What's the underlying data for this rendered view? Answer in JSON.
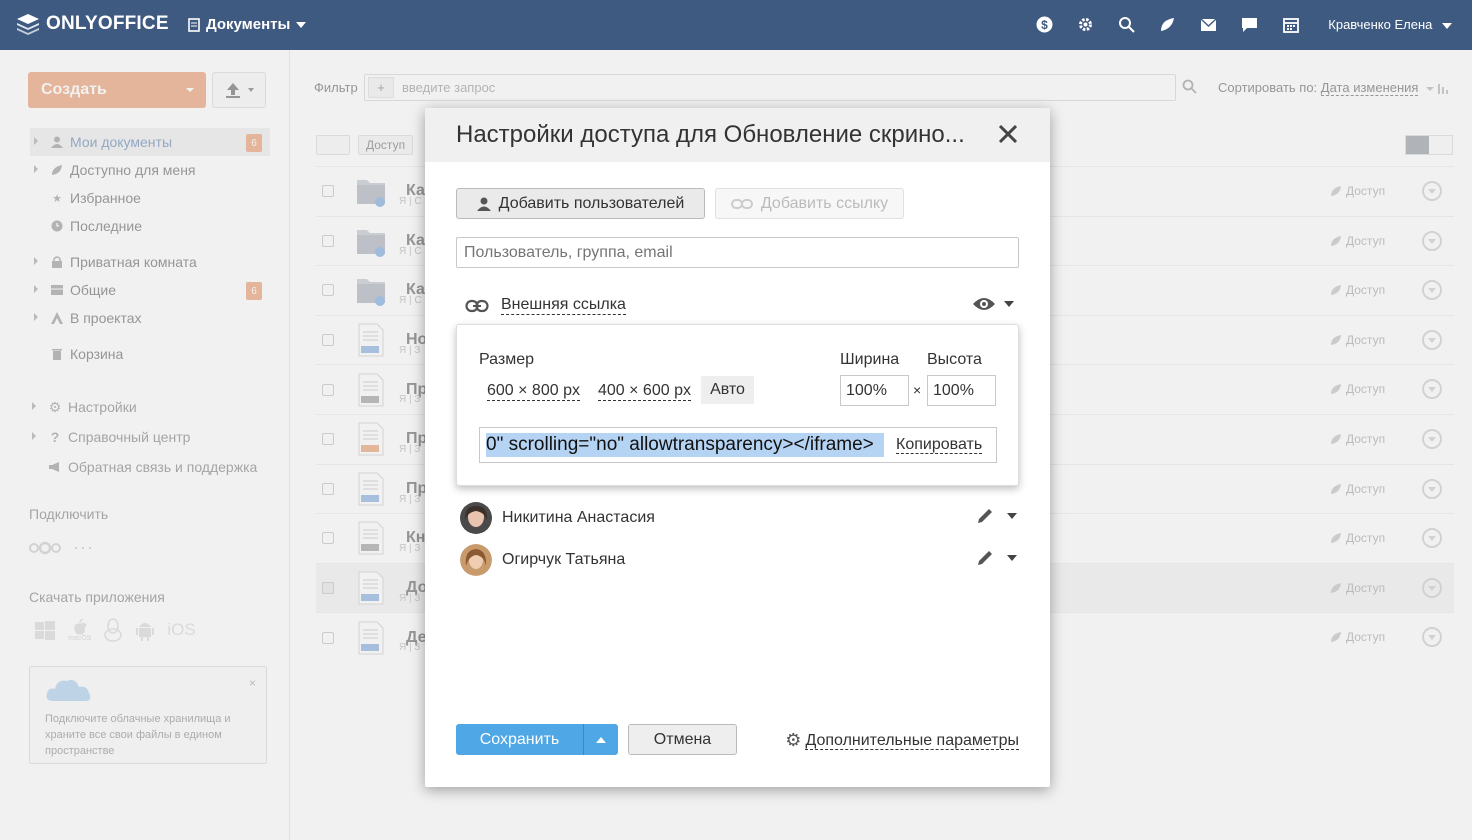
{
  "header": {
    "logo": "ONLYOFFICE",
    "module": "Документы",
    "user": "Кравченко Елена",
    "icons": [
      "payments-icon",
      "settings-icon",
      "search-icon",
      "feed-icon",
      "mail-icon",
      "chat-icon",
      "calendar-icon"
    ]
  },
  "sidebar": {
    "create_label": "Создать",
    "items": [
      {
        "label": "Мои документы",
        "badge": "6"
      },
      {
        "label": "Доступно для меня"
      },
      {
        "label": "Избранное"
      },
      {
        "label": "Последние"
      },
      {
        "label": "Приватная комната"
      },
      {
        "label": "Общие",
        "badge": "6"
      },
      {
        "label": "В проектах"
      },
      {
        "label": "Корзина"
      },
      {
        "label": "Настройки"
      },
      {
        "label": "Справочный центр"
      },
      {
        "label": "Обратная связь и поддержка"
      }
    ],
    "connect_title": "Подключить",
    "download_title": "Скачать приложения",
    "ios_label": "iOS",
    "macos_label": "macOS",
    "promo_text": "Подключите облачные хранилища и храните все свои файлы в едином пространстве"
  },
  "main": {
    "filter_label": "Фильтр",
    "filter_placeholder": "введите запрос",
    "sort_label": "Сортировать по:",
    "sort_value": "Дата изменения",
    "toolbar_access": "Доступ",
    "rows": [
      {
        "name": "Кат",
        "meta": "Я | С",
        "type": "folder"
      },
      {
        "name": "Кат",
        "meta": "Я | С",
        "type": "folder"
      },
      {
        "name": "Кат",
        "meta": "Я | С",
        "type": "folder"
      },
      {
        "name": "Нов",
        "meta": "Я | З",
        "type": "docx"
      },
      {
        "name": "При",
        "meta": "Я | З",
        "type": "xlsx"
      },
      {
        "name": "При",
        "meta": "Я | З",
        "type": "pptx"
      },
      {
        "name": "При",
        "meta": "Я | З",
        "type": "docx"
      },
      {
        "name": "Кни",
        "meta": "Я | З",
        "type": "xlsx"
      },
      {
        "name": "Доі",
        "meta": "Я | З",
        "type": "docx",
        "selected": true
      },
      {
        "name": "Дес",
        "meta": "Я | З",
        "type": "docx"
      }
    ],
    "access_label": "Доступ"
  },
  "dialog": {
    "title": "Настройки доступа для Обновление скрино...",
    "add_users": "Добавить пользователей",
    "add_link": "Добавить ссылку",
    "user_placeholder": "Пользователь, группа, email",
    "external_link": "Внешняя ссылка",
    "embed": {
      "size_label": "Размер",
      "width_label": "Ширина",
      "height_label": "Высота",
      "size_600": "600 × 800 px",
      "size_400": "400 × 600 px",
      "size_auto": "Авто",
      "width_value": "100%",
      "height_value": "100%",
      "times": "×",
      "code": "0\" scrolling=\"no\" allowtransparency></iframe>",
      "copy": "Копировать"
    },
    "shares": [
      {
        "name": "Никитина Анастасия"
      },
      {
        "name": "Огирчук Татьяна"
      }
    ],
    "save": "Сохранить",
    "cancel": "Отмена",
    "advanced": "Дополнительные параметры"
  }
}
